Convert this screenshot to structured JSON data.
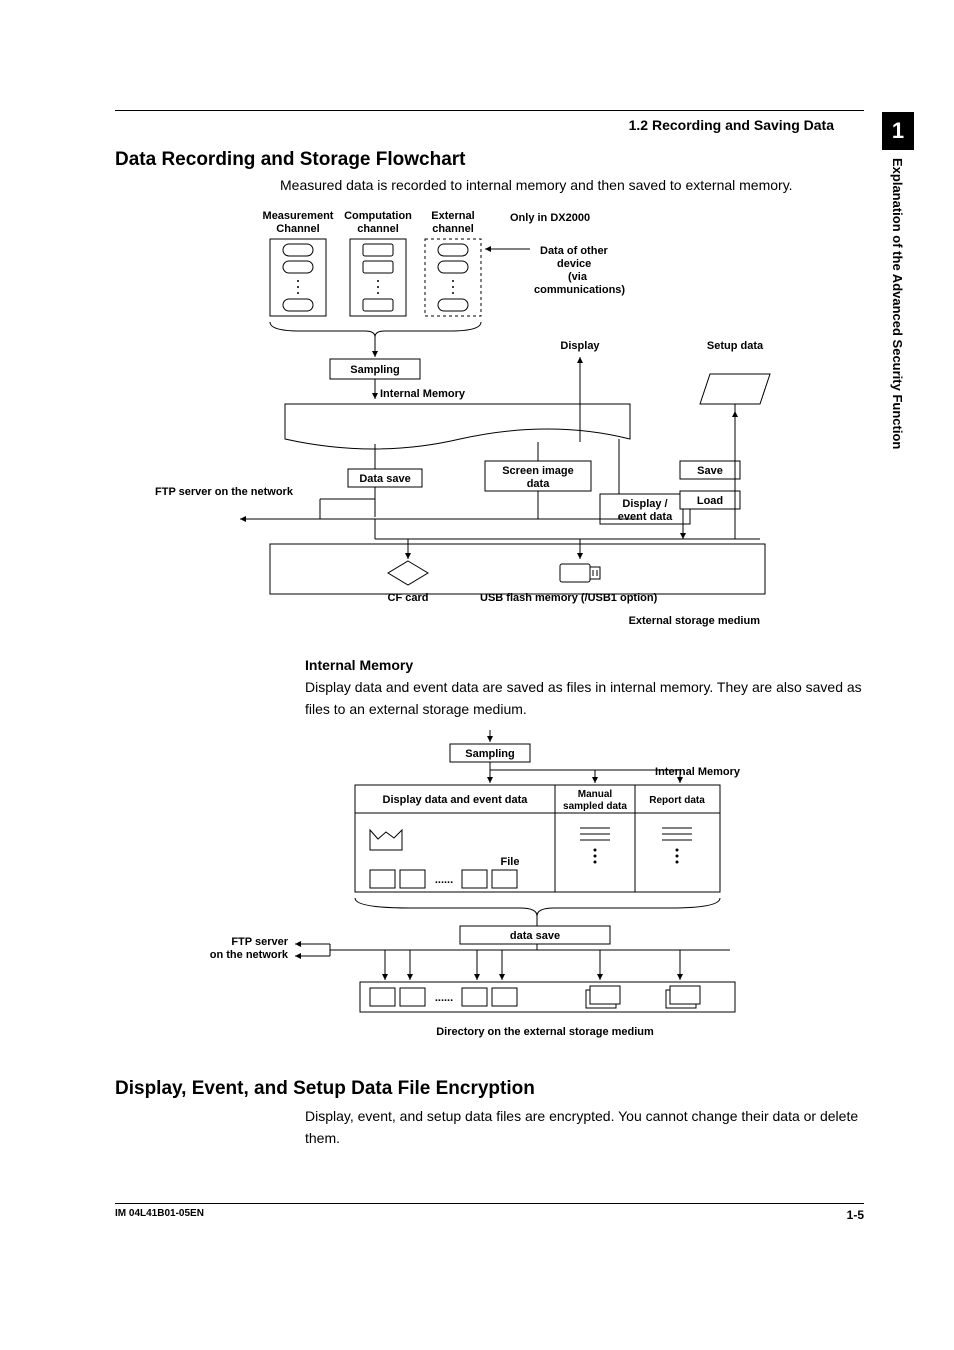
{
  "section_header": "1.2  Recording and Saving Data",
  "h1_a": "Data Recording and Storage Flowchart",
  "lead_a": "Measured data is recorded to internal memory and then saved to external memory.",
  "fig1": {
    "col_meas": "Measurement",
    "col_meas2": "Channel",
    "col_comp": "Computation",
    "col_comp2": "channel",
    "col_ext": "External",
    "col_ext2": "channel",
    "only": "Only in DX2000",
    "other1": "Data of other",
    "other2": "device",
    "other3": "(via",
    "other4": "communications)",
    "sampling": "Sampling",
    "internal": "Internal Memory",
    "display": "Display",
    "setup": "Setup data",
    "datasave": "Data save",
    "screen1": "Screen image",
    "screen2": "data",
    "dispev1": "Display /",
    "dispev2": "event data",
    "save": "Save",
    "load": "Load",
    "ftp": "FTP server on the network",
    "cf": "CF card",
    "usb": "USB flash memory (/USB1 option)",
    "ext_store": "External storage medium"
  },
  "sub_internal": "Internal Memory",
  "body_internal": "Display data and event data are saved as files in internal memory. They are also saved as files to an external storage medium.",
  "fig2": {
    "sampling": "Sampling",
    "internal": "Internal Memory",
    "disp_event": "Display data and event data",
    "manual1": "Manual",
    "manual2": "sampled data",
    "report": "Report data",
    "file": "File",
    "dots": "......",
    "datasave": "data save",
    "ftp1": "FTP server",
    "ftp2": "on the network",
    "dir": "Directory on the external storage medium"
  },
  "h1_b": "Display, Event, and Setup Data File Encryption",
  "body_b": "Display, event, and setup data files are encrypted. You cannot change their data or delete them.",
  "side_chapter": "1",
  "side_text": "Explanation of the Advanced Security Function",
  "doc_id": "IM 04L41B01-05EN",
  "page_no": "1-5"
}
